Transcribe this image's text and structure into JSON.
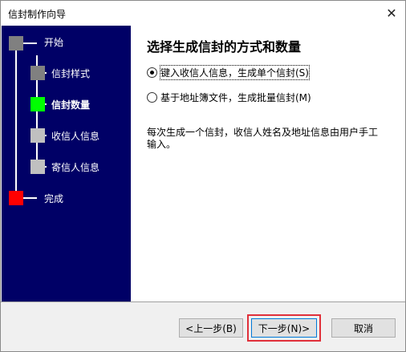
{
  "window": {
    "title": "信封制作向导",
    "close_glyph": "✕"
  },
  "sidebar": {
    "background": "#000066",
    "steps": [
      {
        "label": "开始",
        "color": "#808080",
        "active": false
      },
      {
        "label": "信封样式",
        "color": "#808080",
        "active": false
      },
      {
        "label": "信封数量",
        "color": "#00ff00",
        "active": true
      },
      {
        "label": "收信人信息",
        "color": "#c0c0c0",
        "active": false
      },
      {
        "label": "寄信人信息",
        "color": "#c0c0c0",
        "active": false
      },
      {
        "label": "完成",
        "color": "#ff0000",
        "active": false
      }
    ]
  },
  "content": {
    "title": "选择生成信封的方式和数量",
    "options": [
      {
        "label": "键入收信人信息，生成单个信封(S)",
        "checked": true
      },
      {
        "label": "基于地址簿文件，生成批量信封(M)",
        "checked": false
      }
    ],
    "description": "每次生成一个信封，收信人姓名及地址信息由用户手工输入。"
  },
  "footer": {
    "back_label": "<上一步(B)",
    "next_label": "下一步(N)>",
    "cancel_label": "取消",
    "highlight_color": "#e0303a"
  }
}
